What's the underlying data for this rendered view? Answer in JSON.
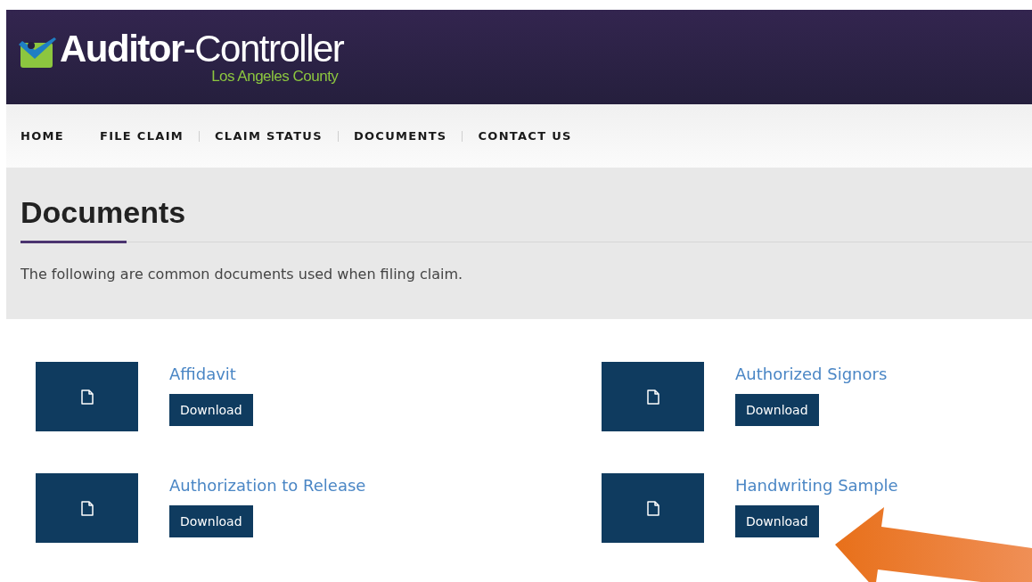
{
  "header": {
    "title_bold": "Auditor",
    "title_light": "-Controller",
    "subtitle": "Los Angeles County"
  },
  "nav": [
    {
      "label": "HOME",
      "divider": false
    },
    {
      "label": "FILE CLAIM",
      "divider": false
    },
    {
      "label": "CLAIM STATUS",
      "divider": true
    },
    {
      "label": "DOCUMENTS",
      "divider": true
    },
    {
      "label": "CONTACT US",
      "divider": true
    }
  ],
  "page": {
    "title": "Documents",
    "intro": "The following are common documents used when filing claim."
  },
  "documents": [
    {
      "title": "Affidavit",
      "button": "Download",
      "highlighted": false
    },
    {
      "title": "Authorized Signors",
      "button": "Download",
      "highlighted": false
    },
    {
      "title": "Authorization to Release",
      "button": "Download",
      "highlighted": false
    },
    {
      "title": "Handwriting Sample",
      "button": "Download",
      "highlighted": true
    }
  ]
}
